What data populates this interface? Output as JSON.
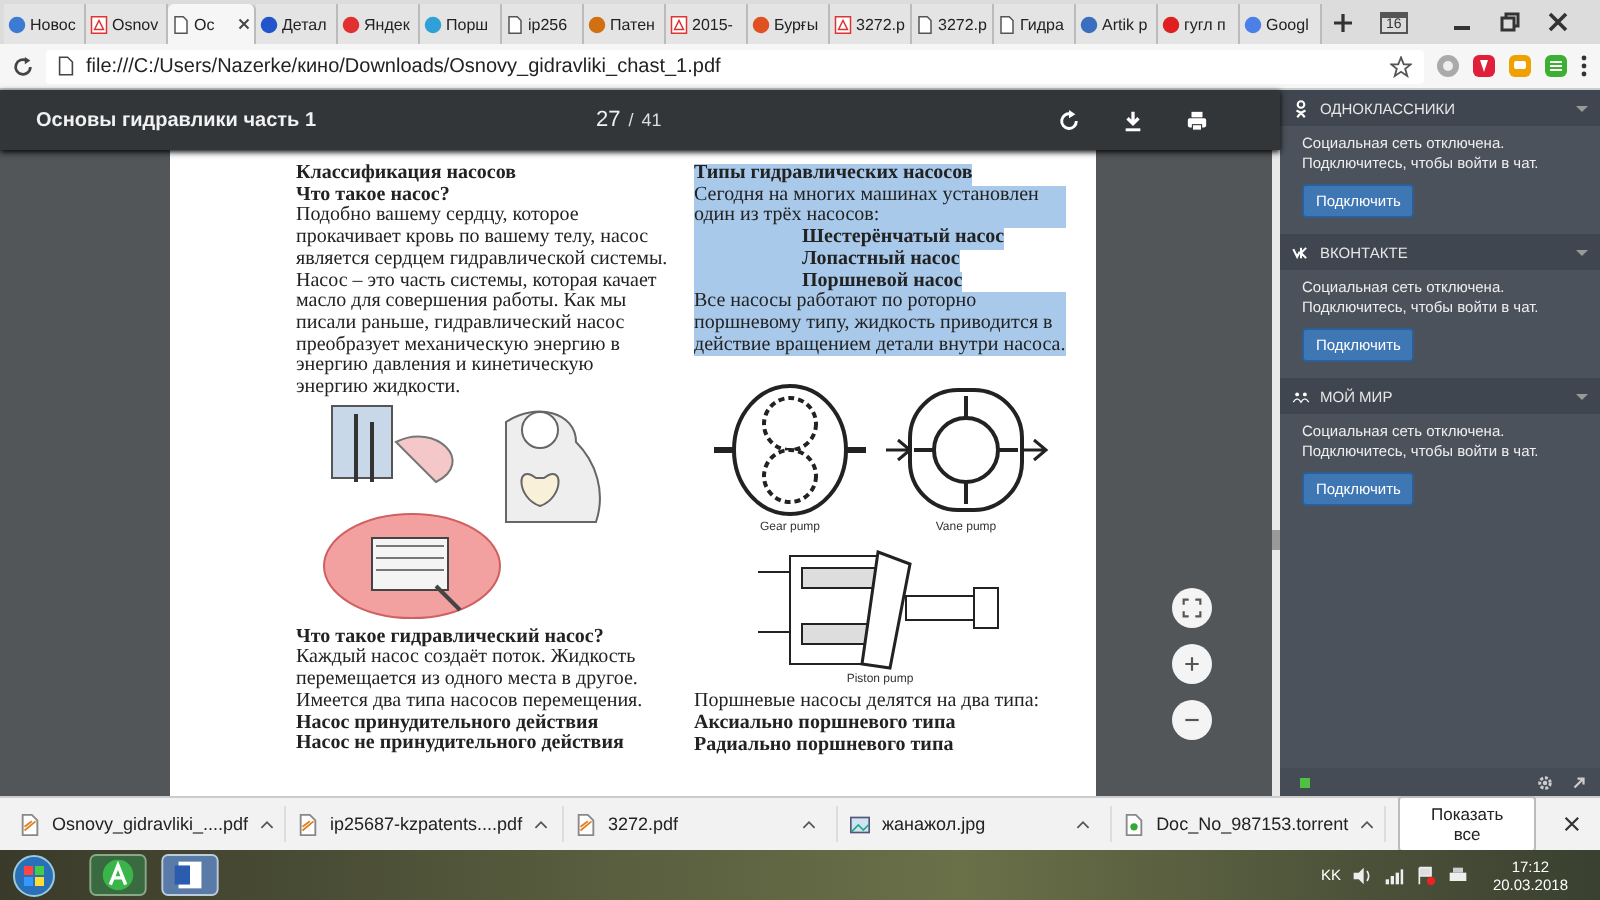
{
  "tabs": [
    {
      "label": "Новос",
      "kind": "site",
      "color": "#3b7bd4",
      "selected": false
    },
    {
      "label": "Osnov",
      "kind": "pdf",
      "selected": false
    },
    {
      "label": "Ос",
      "kind": "page",
      "selected": true
    },
    {
      "label": "Детал",
      "kind": "site",
      "color": "#2255cc",
      "selected": false
    },
    {
      "label": "Яндек",
      "kind": "site",
      "color": "#e03030",
      "selected": false
    },
    {
      "label": "Порш",
      "kind": "site",
      "color": "#2fa0d8",
      "selected": false
    },
    {
      "label": "ip256",
      "kind": "page",
      "selected": false
    },
    {
      "label": "Патен",
      "kind": "site",
      "color": "#d07010",
      "selected": false
    },
    {
      "label": "2015-",
      "kind": "pdf",
      "selected": false
    },
    {
      "label": "Бурғы",
      "kind": "site",
      "color": "#e05020",
      "selected": false
    },
    {
      "label": "3272.p",
      "kind": "pdf",
      "selected": false
    },
    {
      "label": "3272.p",
      "kind": "page",
      "selected": false
    },
    {
      "label": "Гидра",
      "kind": "page",
      "selected": false
    },
    {
      "label": "Artik р",
      "kind": "site",
      "color": "#3a6fc0",
      "selected": false
    },
    {
      "label": "гугл п",
      "kind": "site",
      "color": "#e02020",
      "selected": false
    },
    {
      "label": "Googl",
      "kind": "site",
      "color": "#4a80e8",
      "selected": false
    }
  ],
  "calendar_badge": "16",
  "address": {
    "url": "file:///C:/Users/Nazerke/кино/Downloads/Osnovy_gidravliki_chast_1.pdf"
  },
  "viewer": {
    "title": "Основы гидравлики часть 1",
    "page": "27",
    "separator": "/",
    "total": "41"
  },
  "left_column": [
    {
      "kind": "heading",
      "text": "Классификация насосов",
      "highlighted": false
    },
    {
      "kind": "heading",
      "text": "Что такое насос?",
      "highlighted": false
    },
    {
      "kind": "text",
      "text": "Подобно вашему сердцу, которое прокачивает кровь по вашему телу, насос является сердцем гидравлической системы. Насос – это часть системы, которая качает масло для совершения работы. Как мы писали раньше, гидравлический насос преобразует механическую энергию в энергию давления  и кинетическую энергию жидкости.",
      "highlighted": false
    },
    {
      "kind": "illustration"
    },
    {
      "kind": "heading",
      "text": "Что такое гидравлический насос?",
      "highlighted": false
    },
    {
      "kind": "text",
      "text": "Каждый насос создаёт поток. Жидкость перемещается из одного места в другое. Имеется два типа насосов перемещения.",
      "highlighted": false
    },
    {
      "kind": "heading",
      "text": "Насос принудительного действия",
      "highlighted": false
    },
    {
      "kind": "heading",
      "text": "Насос не принудительного действия",
      "highlighted": false
    }
  ],
  "right_column": [
    {
      "kind": "heading",
      "text": "Типы гидравлических насосов",
      "highlighted": true
    },
    {
      "kind": "text",
      "text": "Сегодня на многих машинах установлен один из трёх насосов:",
      "highlighted": true
    },
    {
      "kind": "indent",
      "text": "Шестерёнчатый насос",
      "highlighted": true
    },
    {
      "kind": "indent",
      "text": "Лопастный насос",
      "highlighted": true
    },
    {
      "kind": "indent",
      "text": "Поршневой насос",
      "highlighted": true
    },
    {
      "kind": "text",
      "text": "Все насосы работают по роторно поршневому типу, жидкость приводится в действие вращением детали внутри насоса.",
      "highlighted": true
    },
    {
      "kind": "pumps",
      "captions": [
        "Gear pump",
        "Vane pump"
      ]
    },
    {
      "kind": "piston",
      "captions": [
        "Piston pump"
      ]
    },
    {
      "kind": "text",
      "text": "Поршневые насосы делятся на два типа:",
      "highlighted": false
    },
    {
      "kind": "heading",
      "text": "Аксиально поршневого типа",
      "highlighted": false
    },
    {
      "kind": "heading",
      "text": "Радиально поршневого типа",
      "highlighted": false
    }
  ],
  "sidebar": [
    {
      "kind": "ok",
      "title": "ОДНОКЛАССНИКИ",
      "lines": [
        "Социальная сеть отключена.",
        "Подключитесь, чтобы войти в чат."
      ],
      "button": "Подключить"
    },
    {
      "kind": "vk",
      "title": "ВКОНТАКТЕ",
      "lines": [
        "Социальная сеть отключена.",
        "Подключитесь, чтобы войти в чат."
      ],
      "button": "Подключить"
    },
    {
      "kind": "mir",
      "title": "МОЙ МИР",
      "lines": [
        "Социальная сеть отключена.",
        "Подключитесь, чтобы войти в чат."
      ],
      "button": "Подключить"
    }
  ],
  "downloads": [
    {
      "name": "Osnovy_gidravliki_....pdf",
      "kind": "pdf"
    },
    {
      "name": "ip25687-kzpatents....pdf",
      "kind": "pdf"
    },
    {
      "name": "3272.pdf",
      "kind": "pdf"
    },
    {
      "name": "жанажол.jpg",
      "kind": "image"
    },
    {
      "name": "Doc_No_987153.torrent",
      "kind": "torrent"
    }
  ],
  "show_all": "Показать все",
  "taskbar": {
    "language": "KK",
    "time": "17:12",
    "date": "20.03.2018"
  }
}
